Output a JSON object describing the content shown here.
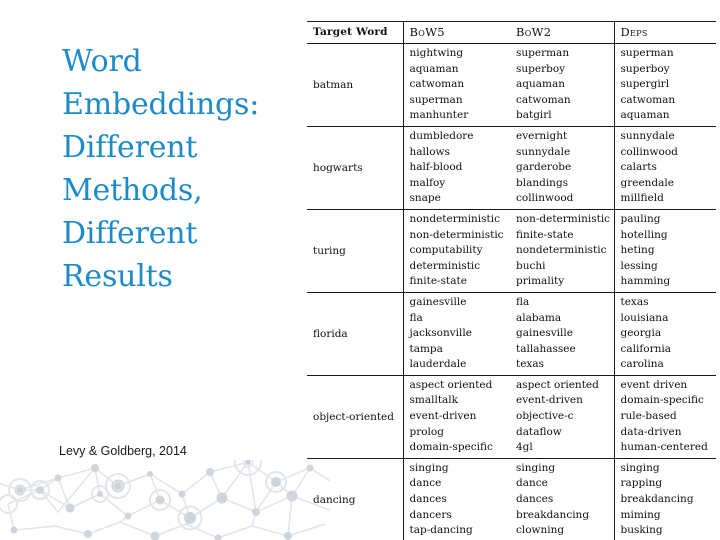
{
  "slide": {
    "title_lines": [
      "Word",
      "Embeddings:",
      "Different",
      "Methods,",
      "Different",
      "Results"
    ],
    "title_color": "#1e8bc9",
    "citation": "Levy & Goldberg, 2014",
    "decor_color": "#dfe3e8"
  },
  "table": {
    "headers": {
      "target": "Target Word",
      "bow5": "BoW5",
      "bow2": "BoW2",
      "deps": "Deps"
    },
    "rows": [
      {
        "target": "batman",
        "bow5": [
          "nightwing",
          "aquaman",
          "catwoman",
          "superman",
          "manhunter"
        ],
        "bow2": [
          "superman",
          "superboy",
          "aquaman",
          "catwoman",
          "batgirl"
        ],
        "deps": [
          "superman",
          "superboy",
          "supergirl",
          "catwoman",
          "aquaman"
        ]
      },
      {
        "target": "hogwarts",
        "bow5": [
          "dumbledore",
          "hallows",
          "half-blood",
          "malfoy",
          "snape"
        ],
        "bow2": [
          "evernight",
          "sunnydale",
          "garderobe",
          "blandings",
          "collinwood"
        ],
        "deps": [
          "sunnydale",
          "collinwood",
          "calarts",
          "greendale",
          "millfield"
        ]
      },
      {
        "target": "turing",
        "bow5": [
          "nondeterministic",
          "non-deterministic",
          "computability",
          "deterministic",
          "finite-state"
        ],
        "bow2": [
          "non-deterministic",
          "finite-state",
          "nondeterministic",
          "buchi",
          "primality"
        ],
        "deps": [
          "pauling",
          "hotelling",
          "heting",
          "lessing",
          "hamming"
        ]
      },
      {
        "target": "florida",
        "bow5": [
          "gainesville",
          "fla",
          "jacksonville",
          "tampa",
          "lauderdale"
        ],
        "bow2": [
          "fla",
          "alabama",
          "gainesville",
          "tallahassee",
          "texas"
        ],
        "deps": [
          "texas",
          "louisiana",
          "georgia",
          "california",
          "carolina"
        ]
      },
      {
        "target": "object-oriented",
        "bow5": [
          "aspect oriented",
          "smalltalk",
          "event-driven",
          "prolog",
          "domain-specific"
        ],
        "bow2": [
          "aspect oriented",
          "event-driven",
          "objective-c",
          "dataflow",
          "4gl"
        ],
        "deps": [
          "event driven",
          "domain-specific",
          "rule-based",
          "data-driven",
          "human-centered"
        ]
      },
      {
        "target": "dancing",
        "bow5": [
          "singing",
          "dance",
          "dances",
          "dancers",
          "tap-dancing"
        ],
        "bow2": [
          "singing",
          "dance",
          "dances",
          "breakdancing",
          "clowning"
        ],
        "deps": [
          "singing",
          "rapping",
          "breakdancing",
          "miming",
          "busking"
        ]
      }
    ]
  }
}
